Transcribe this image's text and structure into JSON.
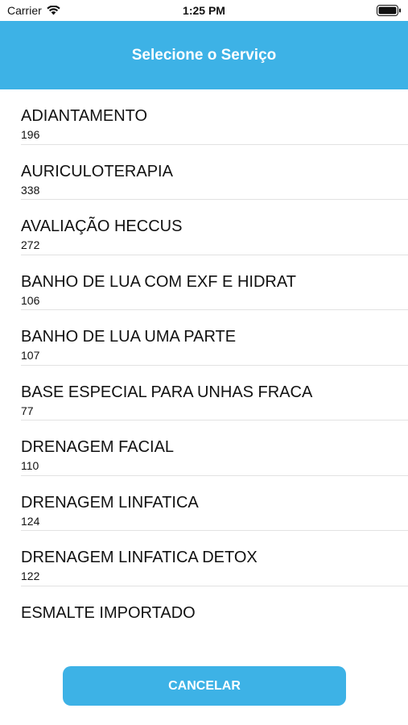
{
  "status_bar": {
    "carrier": "Carrier",
    "time": "1:25 PM",
    "wifi_icon": "wifi-icon",
    "battery_icon": "battery-icon"
  },
  "header": {
    "title": "Selecione o Serviço",
    "background_color": "#3db2e6"
  },
  "services": [
    {
      "name": "ADIANTAMENTO",
      "code": "196"
    },
    {
      "name": "AURICULOTERAPIA",
      "code": "338"
    },
    {
      "name": "AVALIAÇÃO HECCUS",
      "code": "272"
    },
    {
      "name": "BANHO DE LUA COM EXF E HIDRAT",
      "code": "106"
    },
    {
      "name": "BANHO DE LUA UMA PARTE",
      "code": "107"
    },
    {
      "name": "BASE ESPECIAL PARA UNHAS FRACA",
      "code": "77"
    },
    {
      "name": "DRENAGEM FACIAL",
      "code": "110"
    },
    {
      "name": "DRENAGEM LINFATICA",
      "code": "124"
    },
    {
      "name": "DRENAGEM LINFATICA DETOX",
      "code": "122"
    },
    {
      "name": "ESMALTE IMPORTADO",
      "code": ""
    }
  ],
  "footer": {
    "cancel_label": "CANCELAR",
    "button_color": "#3db2e6"
  }
}
